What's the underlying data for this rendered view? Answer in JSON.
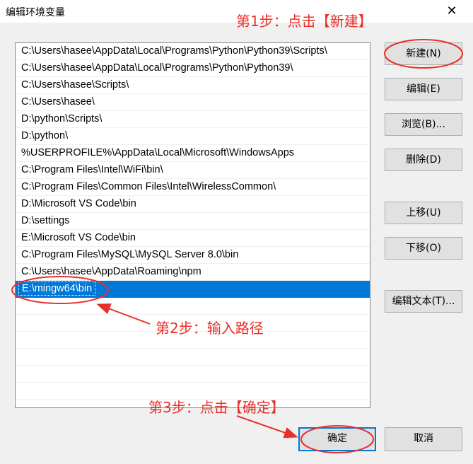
{
  "window": {
    "title": "编辑环境变量",
    "close_glyph": "✕"
  },
  "paths": [
    "C:\\Users\\hasee\\AppData\\Local\\Programs\\Python\\Python39\\Scripts\\",
    "C:\\Users\\hasee\\AppData\\Local\\Programs\\Python\\Python39\\",
    "C:\\Users\\hasee\\Scripts\\",
    "C:\\Users\\hasee\\",
    "D:\\python\\Scripts\\",
    "D:\\python\\",
    "%USERPROFILE%\\AppData\\Local\\Microsoft\\WindowsApps",
    "C:\\Program Files\\Intel\\WiFi\\bin\\",
    "C:\\Program Files\\Common Files\\Intel\\WirelessCommon\\",
    "D:\\Microsoft VS Code\\bin",
    "D:\\settings",
    "E:\\Microsoft VS Code\\bin",
    "C:\\Program Files\\MySQL\\MySQL Server 8.0\\bin",
    "C:\\Users\\hasee\\AppData\\Roaming\\npm"
  ],
  "editing_value": "E:\\mingw64\\bin",
  "buttons": {
    "new": "新建(N)",
    "edit": "编辑(E)",
    "browse": "浏览(B)...",
    "delete": "删除(D)",
    "move_up": "上移(U)",
    "move_down": "下移(O)",
    "edit_text": "编辑文本(T)...",
    "ok": "确定",
    "cancel": "取消"
  },
  "annotations": {
    "step1": "第1步：点击【新建】",
    "step2": "第2步：输入路径",
    "step3": "第3步：点击【确定】"
  },
  "colors": {
    "annotation": "#e8302a",
    "selection": "#0078d7"
  }
}
